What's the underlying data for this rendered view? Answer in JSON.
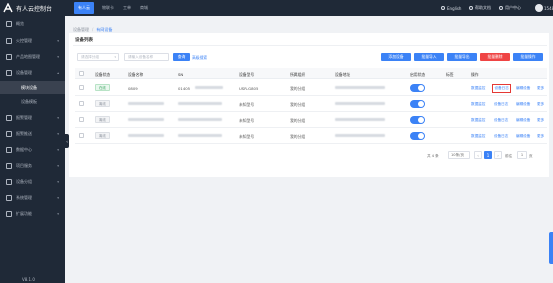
{
  "brand": {
    "name": "有人云控制台"
  },
  "topbar": {
    "tabs": [
      "有人云",
      "物联卡",
      "工单",
      "商城"
    ],
    "english": "English",
    "help": "帮助文档",
    "user_center": "用户中心",
    "user": "15486"
  },
  "sidebar": {
    "items": [
      {
        "label": "概览"
      },
      {
        "label": "火控管理"
      },
      {
        "label": "产品地图管理"
      },
      {
        "label": "设备管理"
      },
      {
        "label": "模块设备"
      },
      {
        "label": "设备模板"
      },
      {
        "label": "报警管理"
      },
      {
        "label": "报警推送"
      },
      {
        "label": "数据中心"
      },
      {
        "label": "项目服务"
      },
      {
        "label": "设备分组"
      },
      {
        "label": "系统管理"
      },
      {
        "label": "扩展功能"
      }
    ],
    "version": "V8.1.0"
  },
  "breadcrumb": [
    "设备管理",
    "有网设备"
  ],
  "card": {
    "title": "设备列表"
  },
  "filters": {
    "group_placeholder": "请选择分组",
    "name_placeholder": "请输入设备名称",
    "search_label": "查询",
    "advanced_label": "高级搜索"
  },
  "actions": [
    "添加设备",
    "批量导入",
    "批量导出",
    "批量删除",
    "批量操作"
  ],
  "table": {
    "columns": [
      "设备状态",
      "设备名称",
      "SN",
      "设备型号",
      "所属组织",
      "设备地址",
      "启用状态",
      "标签",
      "操作"
    ],
    "rows": [
      {
        "status": "在线",
        "name": "0809",
        "sn": "01405",
        "model": "USR-G805",
        "org": "我的分组",
        "ops": [
          "数据监控",
          "设备日志",
          "编辑设备",
          "更多"
        ]
      },
      {
        "status": "离线",
        "name": "",
        "sn": "",
        "model": "未知型号",
        "org": "我的分组",
        "ops": [
          "数据监控",
          "设备日志",
          "编辑设备",
          "更多"
        ]
      },
      {
        "status": "离线",
        "name": "",
        "sn": "",
        "model": "未知型号",
        "org": "我的分组",
        "ops": [
          "数据监控",
          "设备日志",
          "编辑设备",
          "更多"
        ]
      },
      {
        "status": "离线",
        "name": "",
        "sn": "",
        "model": "未知型号",
        "org": "我的分组",
        "ops": [
          "数据监控",
          "设备日志",
          "编辑设备",
          "更多"
        ]
      }
    ]
  },
  "pagination": {
    "total": "共 4 条",
    "page_size": "10条/页",
    "current_page": "1",
    "goto_label": "前往",
    "goto_value": "1",
    "page_suffix": "页"
  }
}
